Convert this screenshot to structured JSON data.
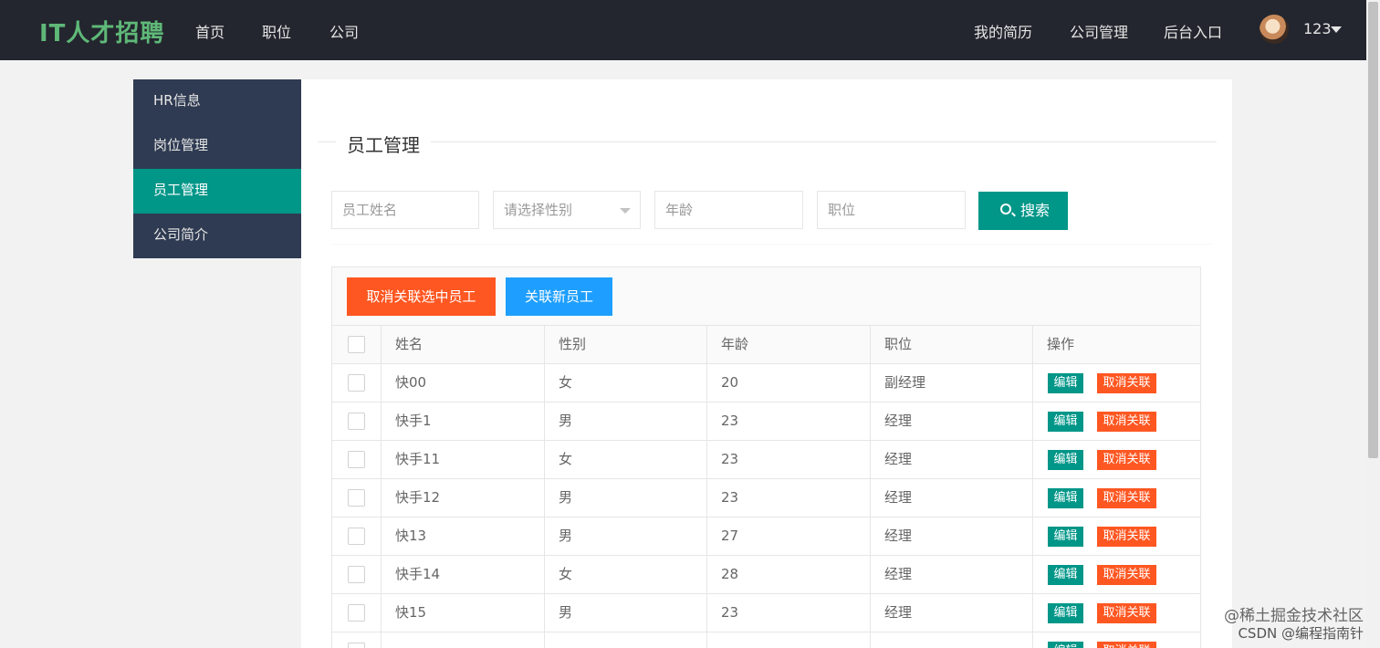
{
  "header": {
    "logo": "IT人才招聘",
    "nav_left": [
      "首页",
      "职位",
      "公司"
    ],
    "nav_right": [
      "我的简历",
      "公司管理",
      "后台入口"
    ],
    "user": "123"
  },
  "sidebar": {
    "items": [
      {
        "label": "HR信息",
        "active": false
      },
      {
        "label": "岗位管理",
        "active": false
      },
      {
        "label": "员工管理",
        "active": true
      },
      {
        "label": "公司简介",
        "active": false
      }
    ]
  },
  "main": {
    "title": "员工管理",
    "filters": {
      "name_placeholder": "员工姓名",
      "gender_placeholder": "请选择性别",
      "age_placeholder": "年龄",
      "position_placeholder": "职位",
      "search_label": "搜索"
    },
    "toolbar": {
      "unlink_selected": "取消关联选中员工",
      "link_new": "关联新员工"
    },
    "table": {
      "columns": [
        "姓名",
        "性别",
        "年龄",
        "职位",
        "操作"
      ],
      "edit_label": "编辑",
      "unlink_label": "取消关联",
      "rows": [
        {
          "name": "快00",
          "gender": "女",
          "age": "20",
          "position": "副经理"
        },
        {
          "name": "快手1",
          "gender": "男",
          "age": "23",
          "position": "经理"
        },
        {
          "name": "快手11",
          "gender": "女",
          "age": "23",
          "position": "经理"
        },
        {
          "name": "快手12",
          "gender": "男",
          "age": "23",
          "position": "经理"
        },
        {
          "name": "快13",
          "gender": "男",
          "age": "27",
          "position": "经理"
        },
        {
          "name": "快手14",
          "gender": "女",
          "age": "28",
          "position": "经理"
        },
        {
          "name": "快15",
          "gender": "男",
          "age": "23",
          "position": "经理"
        },
        {
          "name": "",
          "gender": "",
          "age": "",
          "position": ""
        }
      ]
    }
  },
  "watermark": {
    "line1": "@稀土掘金技术社区",
    "line2": "CSDN @编程指南针"
  },
  "colors": {
    "topbar": "#23262e",
    "logo": "#5fb878",
    "sidebar": "#2f3b52",
    "primary": "#009688",
    "danger": "#ff5722",
    "info": "#1e9fff"
  }
}
